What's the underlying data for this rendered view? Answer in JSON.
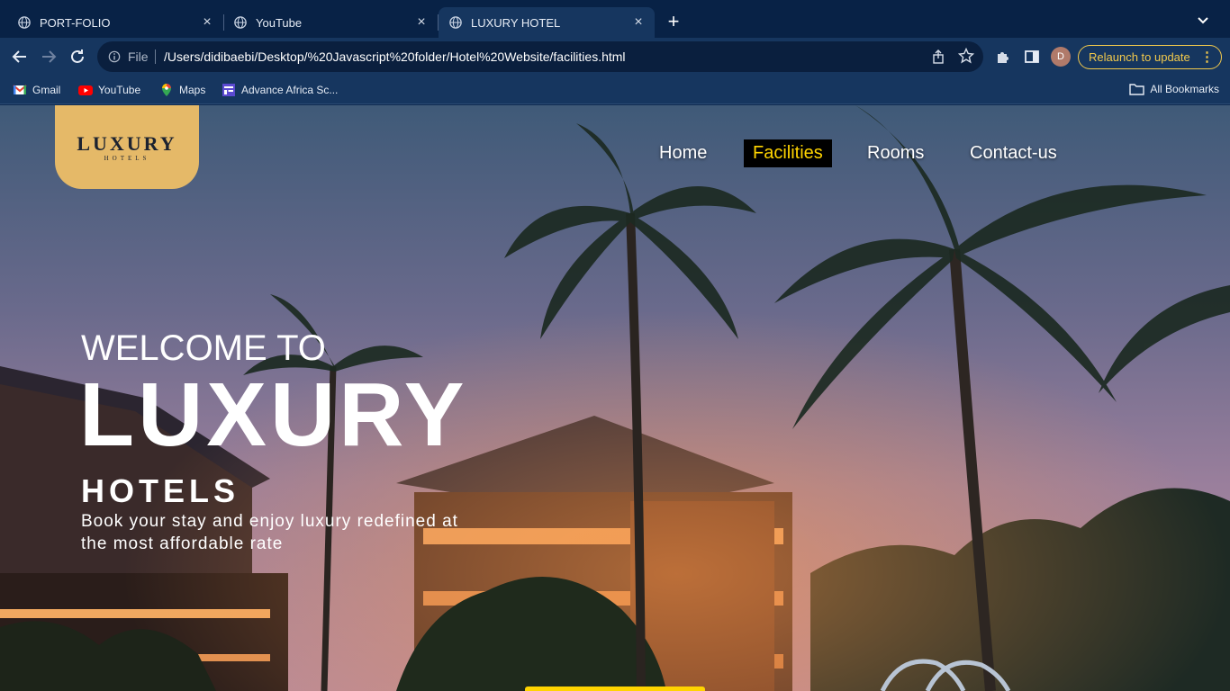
{
  "browser": {
    "tabs": [
      {
        "title": "PORT-FOLIO"
      },
      {
        "title": "YouTube"
      },
      {
        "title": "LUXURY HOTEL"
      }
    ],
    "omnibox": {
      "scheme_label": "File",
      "url": "/Users/didibaebi/Desktop/%20Javascript%20folder/Hotel%20Website/facilities.html"
    },
    "profile_initial": "D",
    "relaunch_label": "Relaunch to update",
    "bookmarks": [
      {
        "label": "Gmail"
      },
      {
        "label": "YouTube"
      },
      {
        "label": "Maps"
      },
      {
        "label": "Advance Africa Sc..."
      }
    ],
    "all_bookmarks_label": "All Bookmarks",
    "accent_color": "#f2c94c"
  },
  "site": {
    "logo": {
      "word": "LUXURY",
      "sub": "HOTELS"
    },
    "nav": [
      {
        "label": "Home",
        "active": false
      },
      {
        "label": "Facilities",
        "active": true
      },
      {
        "label": "Rooms",
        "active": false
      },
      {
        "label": "Contact-us",
        "active": false
      }
    ],
    "hero": {
      "welcome": "WELCOME TO",
      "title": "LUXURY",
      "subtitle": "HOTELS",
      "tagline": "Book your stay and enjoy luxury redefined at the most affordable rate"
    },
    "colors": {
      "logo_bg": "#e5b968",
      "nav_active_text": "#ffd400",
      "nav_active_bg": "#000000"
    }
  }
}
